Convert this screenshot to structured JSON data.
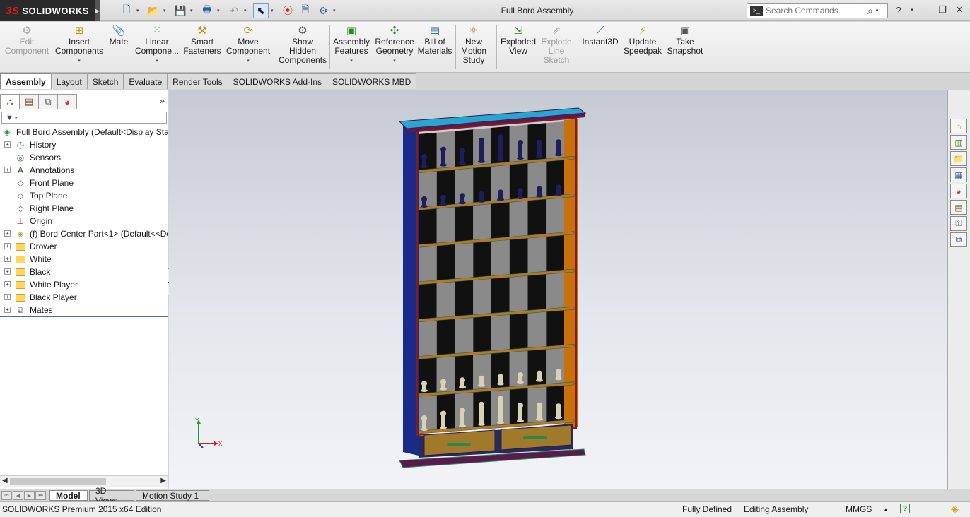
{
  "app": {
    "logo_text": "SOLIDWORKS",
    "logo_mark": "3S"
  },
  "quick_access": {
    "items": [
      "new-icon",
      "open-icon",
      "save-icon",
      "print-icon",
      "undo-icon",
      "select-icon",
      "rebuild-icon",
      "file-properties-icon",
      "options-icon"
    ]
  },
  "window": {
    "title": "Full Bord Assembly"
  },
  "search": {
    "placeholder": "Search Commands"
  },
  "ribbon": {
    "buttons": [
      {
        "id": "edit-component",
        "label": "Edit\nComponent",
        "icon": "edit-component-icon",
        "disabled": true
      },
      {
        "id": "insert-components",
        "label": "Insert\nComponents",
        "icon": "insert-components-icon",
        "dropdown": true
      },
      {
        "id": "mate",
        "label": "Mate",
        "icon": "mate-icon"
      },
      {
        "id": "linear-component",
        "label": "Linear\nCompone...",
        "icon": "linear-pattern-icon",
        "dropdown": true
      },
      {
        "id": "smart-fasteners",
        "label": "Smart\nFasteners",
        "icon": "smart-fasteners-icon"
      },
      {
        "id": "move-component",
        "label": "Move\nComponent",
        "icon": "move-component-icon",
        "dropdown": true
      },
      {
        "id": "show-hidden",
        "label": "Show\nHidden\nComponents",
        "icon": "show-hidden-icon"
      },
      {
        "id": "assembly-features",
        "label": "Assembly\nFeatures",
        "icon": "assembly-features-icon",
        "dropdown": true
      },
      {
        "id": "reference-geometry",
        "label": "Reference\nGeometry",
        "icon": "reference-geometry-icon",
        "dropdown": true
      },
      {
        "id": "bill-of-materials",
        "label": "Bill of\nMaterials",
        "icon": "bom-icon"
      },
      {
        "id": "new-motion-study",
        "label": "New\nMotion\nStudy",
        "icon": "motion-study-icon"
      },
      {
        "id": "exploded-view",
        "label": "Exploded\nView",
        "icon": "exploded-view-icon"
      },
      {
        "id": "explode-line-sketch",
        "label": "Explode\nLine\nSketch",
        "icon": "explode-line-icon",
        "disabled": true
      },
      {
        "id": "instant3d",
        "label": "Instant3D",
        "icon": "instant3d-icon"
      },
      {
        "id": "update-speedpak",
        "label": "Update\nSpeedpak",
        "icon": "speedpak-icon"
      },
      {
        "id": "take-snapshot",
        "label": "Take\nSnapshot",
        "icon": "snapshot-icon"
      }
    ]
  },
  "tabs": [
    "Assembly",
    "Layout",
    "Sketch",
    "Evaluate",
    "Render Tools",
    "SOLIDWORKS Add-Ins",
    "SOLIDWORKS MBD"
  ],
  "active_tab": "Assembly",
  "panel_tabs": [
    "feature-manager-icon",
    "property-manager-icon",
    "configuration-manager-icon",
    "display-manager-icon"
  ],
  "tree": {
    "root": "Full Bord Assembly  (Default<Display Sta",
    "items": [
      {
        "label": "History",
        "icon": "history-icon",
        "expandable": true
      },
      {
        "label": "Sensors",
        "icon": "sensors-icon",
        "expandable": false
      },
      {
        "label": "Annotations",
        "icon": "annotations-icon",
        "expandable": true
      },
      {
        "label": "Front Plane",
        "icon": "plane-icon",
        "expandable": false
      },
      {
        "label": "Top Plane",
        "icon": "plane-icon",
        "expandable": false
      },
      {
        "label": "Right Plane",
        "icon": "plane-icon",
        "expandable": false
      },
      {
        "label": "Origin",
        "icon": "origin-icon",
        "expandable": false
      },
      {
        "label": "(f) Bord Center Part<1> (Default<<De",
        "icon": "part-icon",
        "expandable": true
      },
      {
        "label": "Drower",
        "icon": "folder-icon",
        "expandable": true
      },
      {
        "label": "White",
        "icon": "folder-icon",
        "expandable": true
      },
      {
        "label": "Black",
        "icon": "folder-icon",
        "expandable": true
      },
      {
        "label": "White Player",
        "icon": "folder-icon",
        "expandable": true
      },
      {
        "label": "Black Player",
        "icon": "folder-icon",
        "expandable": true
      },
      {
        "label": "Mates",
        "icon": "mates-icon",
        "expandable": true
      }
    ]
  },
  "bottom_tabs": [
    "Model",
    "3D Views",
    "Motion Study 1"
  ],
  "active_bottom_tab": "Model",
  "status": {
    "edition": "SOLIDWORKS Premium 2015 x64 Edition",
    "state": "Fully Defined",
    "mode": "Editing Assembly",
    "units": "MMGS"
  },
  "triad": {
    "x_label": "X",
    "y_label": "Y"
  },
  "colors": {
    "frame_top": "#27a6d6",
    "frame_side": "#1a2a8a",
    "frame_right": "#c8700c",
    "shelf": "#b07a2a",
    "drawer": "#a07a2a",
    "dark_square": "#111111",
    "light_square": "#8a8a8a"
  }
}
